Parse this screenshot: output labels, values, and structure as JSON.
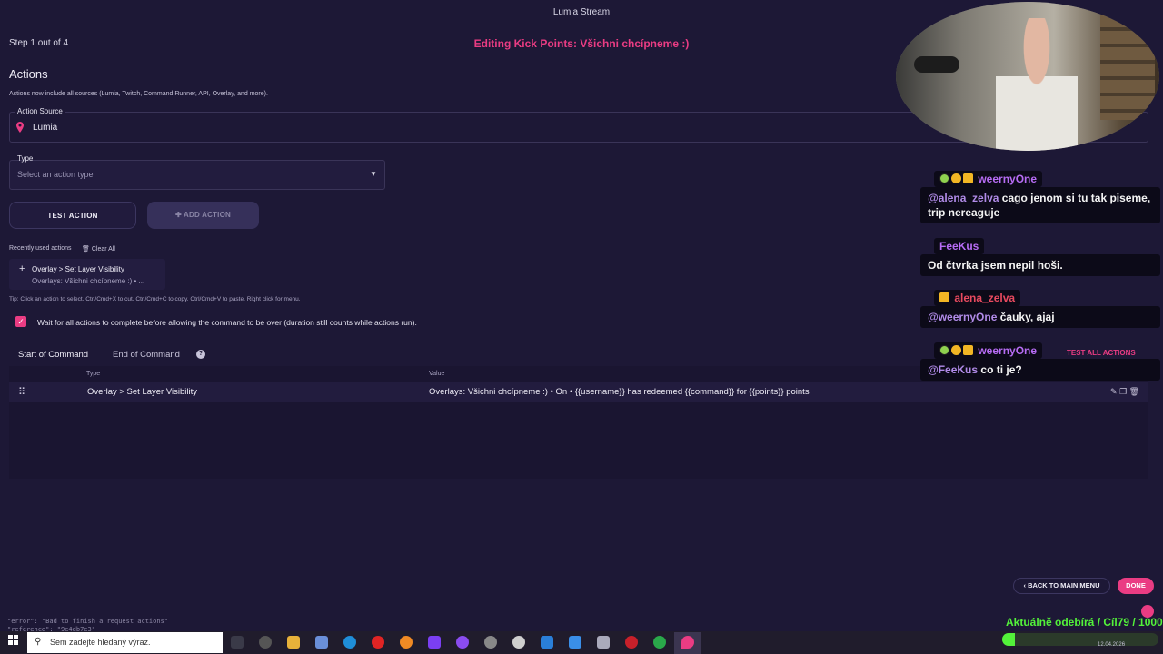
{
  "window": {
    "title": "Lumia Stream"
  },
  "wizard": {
    "step": "Step 1 out of 4",
    "editing_title": "Editing Kick Points: Všichni chcípneme :)"
  },
  "actions": {
    "heading": "Actions",
    "subtitle": "Actions now include all sources (Lumia, Twitch, Command Runner, API, Overlay, and more).",
    "source_label": "Action Source",
    "source_value": "Lumia",
    "type_label": "Type",
    "type_placeholder": "Select an action type",
    "test_action": "TEST ACTION",
    "add_action": "ADD ACTION",
    "recent_label": "Recently used actions",
    "clear_all": "Clear All",
    "recent_items": [
      {
        "title": "Overlay > Set Layer Visibility",
        "subtitle": "Overlays: Všichni chcípneme :) • ..."
      }
    ],
    "tip": "Tip: Click an action to select. Ctrl/Cmd+X to cut. Ctrl/Cmd+C to copy. Ctrl/Cmd+V to paste. Right click for menu.",
    "wait_checkbox": "Wait for all actions to complete before allowing the command to be over (duration still counts while actions run).",
    "wait_checked": true,
    "tabs": [
      "Start of Command",
      "End of Command"
    ],
    "test_all": "TEST ALL ACTIONS",
    "table": {
      "headers": [
        "Type",
        "Value"
      ],
      "rows": [
        {
          "type": "Overlay > Set Layer Visibility",
          "value": "Overlays: Všichni chcípneme :) • On • {{username}} has redeemed {{command}} for {{points}} points"
        }
      ]
    }
  },
  "footer": {
    "back": "BACK TO MAIN MENU",
    "done": "DONE"
  },
  "console_lines": [
    "\"error\": \"Bad to finish a request actions\"",
    "\"reference\": \"9e4db7e3\""
  ],
  "chat": [
    {
      "user": "weernyOne",
      "user_color": "#b76cf4",
      "badges": true,
      "mention": "@alena_zelva",
      "text": "cago jenom si tu tak piseme, trip nereaguje"
    },
    {
      "user": "FeeKus",
      "user_color": "#b76cf4",
      "badges": false,
      "mention": "",
      "text": "Od čtvrka jsem nepil hoši."
    },
    {
      "user": "alena_zelva",
      "user_color": "#e84a5f",
      "badges": true,
      "mention": "@weernyOne",
      "text": "čauky, ajaj"
    },
    {
      "user": "weernyOne",
      "user_color": "#b76cf4",
      "badges": true,
      "mention": "@FeeKus",
      "text": "co ti je?"
    }
  ],
  "goal": {
    "text": "Aktuálně odebírá / Cíl79 / 1000",
    "progress": 0.079
  },
  "taskbar": {
    "search_placeholder": "Sem zadejte hledaný výraz.",
    "date": "12.04.2026"
  },
  "colors": {
    "accent": "#ea3c83",
    "background": "#1d1836",
    "goal": "#53f23a"
  }
}
